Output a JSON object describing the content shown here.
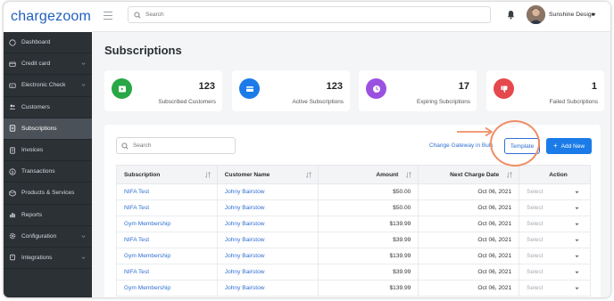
{
  "brand": {
    "logo_text": "chargezoom",
    "primary_color": "#1b7be8",
    "sidebar_bg": "#2c3136"
  },
  "topbar": {
    "search_placeholder": "Search",
    "user_name": "Sunshine Design"
  },
  "sidebar": {
    "items": [
      {
        "label": "Dashboard",
        "icon": "home-icon",
        "expandable": false
      },
      {
        "label": "Credit card",
        "icon": "credit-card-icon",
        "expandable": true
      },
      {
        "label": "Electronic Check",
        "icon": "check-icon",
        "expandable": true
      },
      {
        "label": "Customers",
        "icon": "users-icon",
        "expandable": false
      },
      {
        "label": "Subscriptions",
        "icon": "subscriptions-icon",
        "expandable": false,
        "active": true
      },
      {
        "label": "Invoices",
        "icon": "invoice-icon",
        "expandable": false
      },
      {
        "label": "Transactions",
        "icon": "dollar-icon",
        "expandable": false
      },
      {
        "label": "Products & Services",
        "icon": "box-icon",
        "expandable": false
      },
      {
        "label": "Reports",
        "icon": "bar-chart-icon",
        "expandable": false
      },
      {
        "label": "Configuration",
        "icon": "gear-icon",
        "expandable": true
      },
      {
        "label": "Integrations",
        "icon": "plug-icon",
        "expandable": true
      }
    ]
  },
  "main": {
    "title": "Subscriptions",
    "stats": [
      {
        "value": "123",
        "label": "Subscribed Customers",
        "color": "#28a745",
        "icon": "play-icon"
      },
      {
        "value": "123",
        "label": "Active Subscriptions",
        "color": "#1b7be8",
        "icon": "card-icon"
      },
      {
        "value": "17",
        "label": "Expiring Subcriptions",
        "color": "#9b51e0",
        "icon": "clock-icon"
      },
      {
        "value": "1",
        "label": "Failed Subcriptions",
        "color": "#e5484d",
        "icon": "thumbs-down-icon"
      }
    ],
    "toolbar": {
      "search_placeholder": "Search",
      "bulk_link": "Change Gateway in Bulk",
      "template_label": "Template",
      "add_label": "Add New",
      "add_icon": "+"
    },
    "table": {
      "columns": [
        "Subscription",
        "Customer Name",
        "Amount",
        "Next Charge Date",
        "Action"
      ],
      "rows": [
        {
          "subscription": "NIFA Test",
          "customer": "Johny Bairstow",
          "amount": "$50.00",
          "date": "Oct 06, 2021",
          "action": "Select"
        },
        {
          "subscription": "NIFA Test",
          "customer": "Johny Bairstow",
          "amount": "$50.00",
          "date": "Oct 06, 2021",
          "action": "Select"
        },
        {
          "subscription": "Gym Membership",
          "customer": "Johny Bairstow",
          "amount": "$139.99",
          "date": "Oct 06, 2021",
          "action": "Select"
        },
        {
          "subscription": "NIFA Test",
          "customer": "Johny Bairstow",
          "amount": "$39.99",
          "date": "Oct 06, 2021",
          "action": "Select"
        },
        {
          "subscription": "Gym Membership",
          "customer": "Johny Bairstow",
          "amount": "$139.99",
          "date": "Oct 06, 2021",
          "action": "Select"
        },
        {
          "subscription": "NIFA Test",
          "customer": "Johny Bairstow",
          "amount": "$39.99",
          "date": "Oct 06, 2021",
          "action": "Select"
        },
        {
          "subscription": "Gym Membership",
          "customer": "Johny Bairstow",
          "amount": "$139.99",
          "date": "Oct 06, 2021",
          "action": "Select"
        }
      ]
    }
  },
  "annotation": {
    "highlight_color": "#f08e66"
  }
}
